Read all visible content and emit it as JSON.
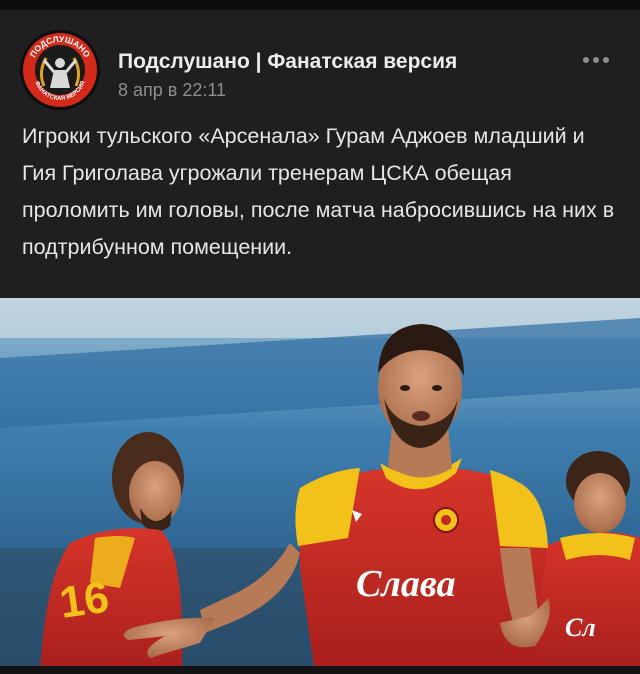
{
  "post": {
    "author": "Подслушано | Фанатская версия",
    "date": "8 апр в 22:11",
    "text": "Игроки тульского «Арсенала» Гурам Аджоев младший и Гия Григолава угрожали тренерам ЦСКА обещая проломить им головы, после матча набросившись на них в подтрибунном помещении."
  },
  "avatar": {
    "logo_text_top": "ПОДСЛУШАНО",
    "logo_text_bottom": "ФАНАТСКАЯ ВЕРСИЯ"
  },
  "photo": {
    "sponsor_text": "Слава",
    "icon": "photo-image"
  },
  "icons": {
    "more": "more-horizontal-icon"
  },
  "colors": {
    "background": "#1f1f20",
    "text": "#e6e6e6",
    "muted": "#8d8d92",
    "jersey_red": "#c42a25",
    "jersey_yellow": "#f2c21a"
  }
}
